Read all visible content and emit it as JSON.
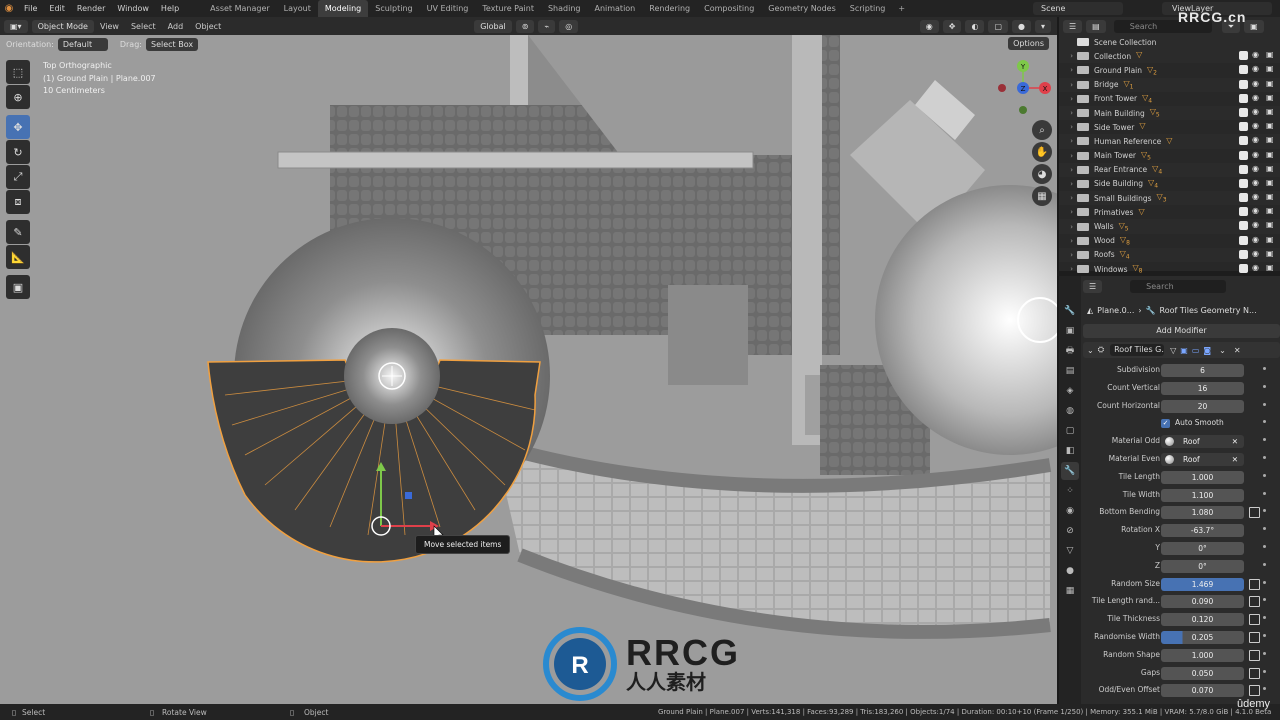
{
  "menu": [
    "File",
    "Edit",
    "Render",
    "Window",
    "Help"
  ],
  "workspaces": [
    "Asset Manager",
    "Layout",
    "Modeling",
    "Sculpting",
    "UV Editing",
    "Texture Paint",
    "Shading",
    "Animation",
    "Rendering",
    "Compositing",
    "Geometry Nodes",
    "Scripting"
  ],
  "active_workspace": "Modeling",
  "scene": "Scene",
  "view_layer": "ViewLayer",
  "viewport_header": {
    "mode": "Object Mode",
    "menus": [
      "View",
      "Select",
      "Add",
      "Object"
    ],
    "transform_orientation": "Global"
  },
  "tool_header": {
    "orientation_label": "Orientation:",
    "orientation_value": "Default",
    "drag_label": "Drag:",
    "drag_value": "Select Box",
    "options": "Options"
  },
  "viewport_info": {
    "view": "Top Orthographic",
    "object": "(1) Ground Plain | Plane.007",
    "scale": "10 Centimeters"
  },
  "gizmo_axes": {
    "y": "Y",
    "z": "Z",
    "x": "X"
  },
  "tooltip": "Move selected items",
  "outliner": {
    "search_placeholder": "Search",
    "root": "Scene Collection",
    "items": [
      {
        "name": "Collection",
        "badge": ""
      },
      {
        "name": "Ground Plain",
        "badge": "2"
      },
      {
        "name": "Bridge",
        "badge": "1"
      },
      {
        "name": "Front Tower",
        "badge": "4"
      },
      {
        "name": "Main Building",
        "badge": "5"
      },
      {
        "name": "Side Tower",
        "badge": ""
      },
      {
        "name": "Human Reference",
        "badge": ""
      },
      {
        "name": "Main Tower",
        "badge": "5"
      },
      {
        "name": "Rear Entrance",
        "badge": "4"
      },
      {
        "name": "Side Building",
        "badge": "4"
      },
      {
        "name": "Small Buildings",
        "badge": "3"
      },
      {
        "name": "Primatives",
        "badge": ""
      },
      {
        "name": "Walls",
        "badge": "5"
      },
      {
        "name": "Wood",
        "badge": "8"
      },
      {
        "name": "Roofs",
        "badge": "4"
      },
      {
        "name": "Windows",
        "badge": "8"
      }
    ]
  },
  "properties": {
    "search_placeholder": "Search",
    "breadcrumb_object": "Plane.0...",
    "breadcrumb_modifier": "Roof  Tiles Geometry N...",
    "add_modifier": "Add Modifier",
    "modifier_name": "Roof  Tiles G...",
    "rows": [
      {
        "label": "Subdivision",
        "value": "6"
      },
      {
        "label": "Count Vertical",
        "value": "16"
      },
      {
        "label": "Count Horizontal",
        "value": "20"
      }
    ],
    "auto_smooth": "Auto Smooth",
    "material_odd_label": "Material Odd",
    "material_odd": "Roof",
    "material_even_label": "Material Even",
    "material_even": "Roof",
    "rows2": [
      {
        "label": "Tile Length",
        "value": "1.000"
      },
      {
        "label": "Tile Width",
        "value": "1.100"
      },
      {
        "label": "Bottom Bending",
        "value": "1.080"
      },
      {
        "label": "Rotation X",
        "value": "-63.7°"
      },
      {
        "label": "Y",
        "value": "0°"
      },
      {
        "label": "Z",
        "value": "0°"
      },
      {
        "label": "Random Size",
        "value": "1.469"
      },
      {
        "label": "Tile Length rand...",
        "value": "0.090"
      },
      {
        "label": "Tile Thickness",
        "value": "0.120"
      },
      {
        "label": "Randomise Width",
        "value": "0.205"
      },
      {
        "label": "Random Shape",
        "value": "1.000"
      },
      {
        "label": "Gaps",
        "value": "0.050"
      },
      {
        "label": "Odd/Even Offset",
        "value": "0.070"
      }
    ]
  },
  "statusbar": {
    "select": "Select",
    "rotate": "Rotate View",
    "object": "Object",
    "stats": "Ground Plain | Plane.007 | Verts:141,318 | Faces:93,289 | Tris:183,260 | Objects:1/74 | Duration: 00:10+10 (Frame 1/250) | Memory: 355.1 MiB | VRAM: 5.7/8.0 GiB | 4.1.0 Beta"
  },
  "watermark": {
    "brand": "RRCG",
    "sub": "人人素材",
    "corner": "RRCG.cn"
  },
  "udemy": "ûdemy",
  "colors": {
    "accent": "#4772b3",
    "selection": "#f0a040",
    "viewport_bg": "#9c9c9c"
  }
}
